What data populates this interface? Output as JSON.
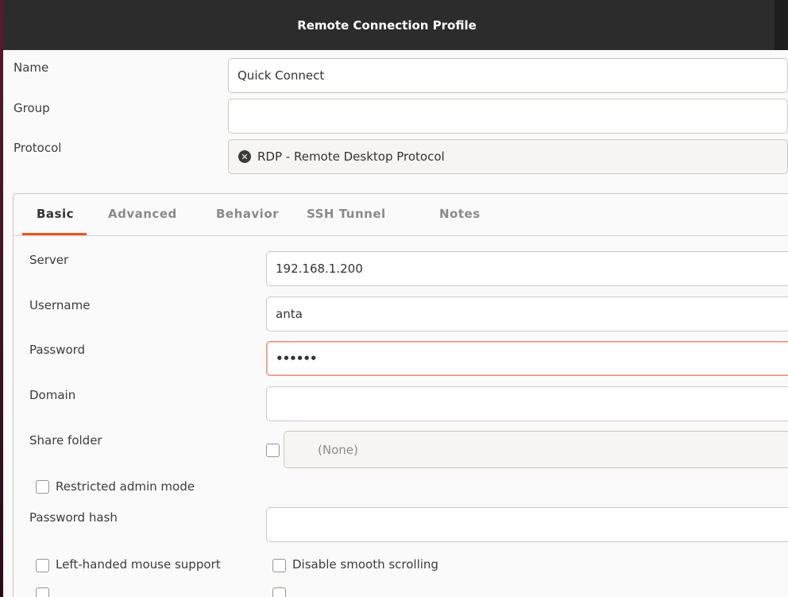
{
  "window": {
    "title": "Remote Connection Profile"
  },
  "profile": {
    "name_label": "Name",
    "name_value": "Quick Connect",
    "group_label": "Group",
    "group_value": "",
    "protocol_label": "Protocol",
    "protocol_value": "RDP - Remote Desktop Protocol",
    "protocol_icon": "rdp-protocol-icon"
  },
  "tabs": [
    {
      "label": "Basic",
      "active": true
    },
    {
      "label": "Advanced",
      "active": false
    },
    {
      "label": "Behavior",
      "active": false
    },
    {
      "label": "SSH Tunnel",
      "active": false
    },
    {
      "label": "Notes",
      "active": false
    }
  ],
  "basic": {
    "server_label": "Server",
    "server_value": "192.168.1.200",
    "username_label": "Username",
    "username_value": "anta",
    "password_label": "Password",
    "password_value": "••••••",
    "domain_label": "Domain",
    "domain_value": "",
    "share_folder_label": "Share folder",
    "share_folder_value": "(None)",
    "restricted_admin_label": "Restricted admin mode",
    "password_hash_label": "Password hash",
    "password_hash_value": "",
    "left_handed_label": "Left-handed mouse support",
    "disable_smooth_label": "Disable smooth scrolling"
  },
  "colors": {
    "accent": "#e95420",
    "titlebar": "#2c2c2c",
    "focus_border": "#e9967d"
  }
}
